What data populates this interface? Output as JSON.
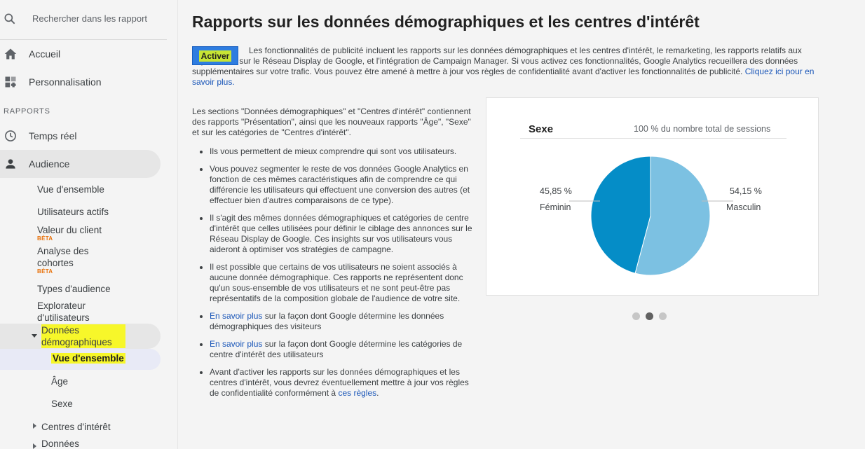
{
  "sidebar": {
    "search_placeholder": "Rechercher dans les rapport",
    "home": "Accueil",
    "custom": "Personnalisation",
    "section": "RAPPORTS",
    "realtime": "Temps réel",
    "audience": "Audience",
    "audience_items": {
      "overview": "Vue d'ensemble",
      "active_users": "Utilisateurs actifs",
      "lifetime_value": "Valeur du client",
      "beta1": "BÉTA",
      "cohort": "Analyse des cohortes",
      "beta2": "BÉTA",
      "audience_types": "Types d'audience",
      "user_explorer": "Explorateur d'utilisateurs",
      "demographics": "Données démographiques",
      "demo_overview": "Vue d'ensemble",
      "age": "Âge",
      "gender": "Sexe",
      "interests": "Centres d'intérêt",
      "geo": "Données"
    }
  },
  "main": {
    "title": "Rapports sur les données démographiques et les centres d'intérêt",
    "activate_button": "Activer",
    "intro_text": "Les fonctionnalités de publicité incluent les rapports sur les données démographiques et les centres d'intérêt, le remarketing, les rapports relatifs aux impressions sur le Réseau Display de Google, et l'intégration de Campaign Manager. Si vous activez ces fonctionnalités, Google Analytics recueillera des données supplémentaires sur votre trafic. Vous pouvez être amené à mettre à jour vos règles de confidentialité avant d'activer les fonctionnalités de publicité.",
    "intro_link": "Cliquez ici pour en savoir plus.",
    "lead": "Les sections \"Données démographiques\" et \"Centres d'intérêt\" contiennent des rapports \"Présentation\", ainsi que les nouveaux rapports \"Âge\", \"Sexe\" et sur les catégories de \"Centres d'intérêt\".",
    "bullet1": "Ils vous permettent de mieux comprendre qui sont vos utilisateurs.",
    "bullet2": "Vous pouvez segmenter le reste de vos données Google Analytics en fonction de ces mêmes caractéristiques afin de comprendre ce qui différencie les utilisateurs qui effectuent une conversion des autres (et effectuer bien d'autres comparaisons de ce type).",
    "bullet3": "Il s'agit des mêmes données démographiques et catégories de centre d'intérêt que celles utilisées pour définir le ciblage des annonces sur le Réseau Display de Google. Ces insights sur vos utilisateurs vous aideront à optimiser vos stratégies de campagne.",
    "bullet4": "Il est possible que certains de vos utilisateurs ne soient associés à aucune donnée démographique. Ces rapports ne représentent donc qu'un sous-ensemble de vos utilisateurs et ne sont peut-être pas représentatifs de la composition globale de l'audience de votre site.",
    "bullet5_link": "En savoir plus",
    "bullet5": " sur la façon dont Google détermine les données démographiques des visiteurs",
    "bullet6_link": "En savoir plus",
    "bullet6": " sur la façon dont Google détermine les catégories de centre d'intérêt des utilisateurs",
    "bullet7": "Avant d'activer les rapports sur les données démographiques et les centres d'intérêt, vous devrez éventuellement mettre à jour vos règles de confidentialité conformément à ",
    "bullet7_link": "ces règles",
    "bullet7_end": "."
  },
  "chart_data": {
    "type": "pie",
    "title": "Sexe",
    "subtitle": "100 % du nombre total de sessions",
    "slices": [
      {
        "label": "Féminin",
        "value": 45.85,
        "display": "45,85 %",
        "color": "#058dc7"
      },
      {
        "label": "Masculin",
        "value": 54.15,
        "display": "54,15 %",
        "color": "#7cc1e2"
      }
    ]
  },
  "carousel": {
    "count": 3,
    "active": 1
  }
}
